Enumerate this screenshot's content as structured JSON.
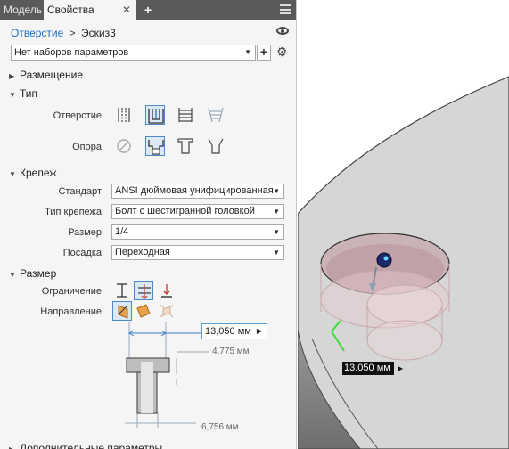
{
  "tabs": {
    "model": "Модель",
    "properties": "Свойства",
    "close": "✕",
    "add": "+"
  },
  "breadcrumb": {
    "feature": "Отверстие",
    "separator": ">",
    "sketch": "Эскиз3"
  },
  "preset": {
    "value": "Нет наборов параметров",
    "add": "+"
  },
  "sections": {
    "placement": "Размещение",
    "type": "Тип",
    "fastener": "Крепеж",
    "size": "Размер",
    "advanced": "Дополнительные параметры"
  },
  "type": {
    "hole_label": "Отверстие",
    "seat_label": "Опора",
    "hole_options": [
      "simple-hole",
      "clearance-hole",
      "tapped-hole",
      "taper-tapped-hole"
    ],
    "hole_selected": 1,
    "seat_options": [
      "none",
      "counterbore",
      "countersink-spotface",
      "countersink"
    ],
    "seat_selected": 1
  },
  "fastener": {
    "standard_label": "Стандарт",
    "standard_value": "ANSI дюймовая унифицированная",
    "type_label": "Тип крепежа",
    "type_value": "Болт с шестигранной головкой",
    "size_label": "Размер",
    "size_value": "1/4",
    "fit_label": "Посадка",
    "fit_value": "Переходная"
  },
  "size": {
    "termination_label": "Ограничение",
    "direction_label": "Направление",
    "termination_selected": 1,
    "direction_selected": 0
  },
  "dimensions": {
    "cbore_diameter": "13,050 мм",
    "cbore_depth": "4,775 мм",
    "hole_diameter": "6,756 мм"
  },
  "viewport": {
    "dim_label": "13.050 мм",
    "colors": {
      "body": "#d6d6d6",
      "body_dark": "#8d8d8d",
      "hole_tint": "#c7a8ad",
      "manipulator": "#3ddb3d"
    }
  }
}
